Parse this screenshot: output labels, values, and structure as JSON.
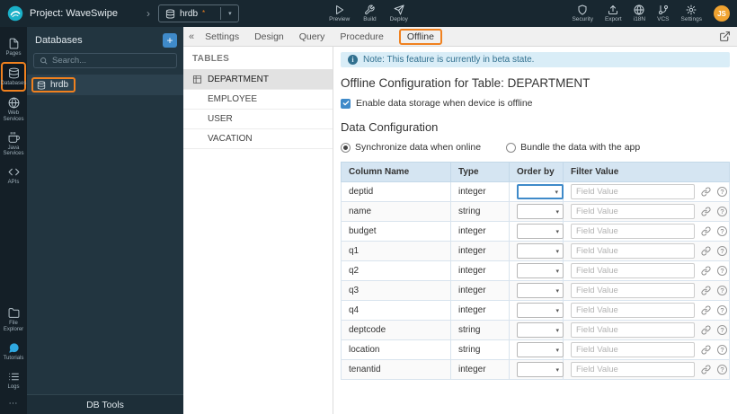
{
  "topbar": {
    "project_label": "Project: WaveSwipe",
    "breadcrumb_chevron": "›",
    "db_selector": {
      "value": "hrdb",
      "modified_marker": "*",
      "caret": "▾"
    },
    "center_actions": [
      {
        "label": "Preview"
      },
      {
        "label": "Build"
      },
      {
        "label": "Deploy"
      }
    ],
    "right_actions": [
      {
        "label": "Security"
      },
      {
        "label": "Export"
      },
      {
        "label": "i18N"
      },
      {
        "label": "VCS"
      },
      {
        "label": "Settings"
      }
    ],
    "avatar_initials": "JS"
  },
  "rail": {
    "items": [
      {
        "label": "Pages"
      },
      {
        "label": "Databases",
        "active": true
      },
      {
        "label": "Web Services"
      },
      {
        "label": "Java Services"
      },
      {
        "label": "APIs"
      },
      {
        "label": "File Explorer"
      },
      {
        "label": "Tutorials"
      },
      {
        "label": "Logs"
      }
    ],
    "overflow": "⋯"
  },
  "db_panel": {
    "title": "Databases",
    "add_button": "+",
    "search_placeholder": "Search...",
    "items": [
      {
        "label": "hrdb",
        "active": true
      }
    ],
    "footer": "DB Tools"
  },
  "tabbar": {
    "collapse_icon": "«",
    "tabs": [
      {
        "label": "Settings"
      },
      {
        "label": "Design"
      },
      {
        "label": "Query"
      },
      {
        "label": "Procedure"
      },
      {
        "label": "Offline",
        "active": true
      }
    ]
  },
  "tables_panel": {
    "title": "TABLES",
    "items": [
      {
        "label": "DEPARTMENT",
        "active": true
      },
      {
        "label": "EMPLOYEE"
      },
      {
        "label": "USER"
      },
      {
        "label": "VACATION"
      }
    ]
  },
  "content": {
    "note": "Note: This feature is currently in beta state.",
    "note_icon": "i",
    "title": "Offline Configuration for Table: DEPARTMENT",
    "enable_checkbox": {
      "label": "Enable data storage when device is offline",
      "checked": true
    },
    "section_title": "Data Configuration",
    "radios": [
      {
        "label": "Synchronize data when online",
        "selected": true
      },
      {
        "label": "Bundle the data with the app",
        "selected": false
      }
    ],
    "table": {
      "headers": [
        "Column Name",
        "Type",
        "Order by",
        "Filter Value"
      ],
      "filter_placeholder": "Field Value",
      "rows": [
        {
          "name": "deptid",
          "type": "integer"
        },
        {
          "name": "name",
          "type": "string"
        },
        {
          "name": "budget",
          "type": "integer"
        },
        {
          "name": "q1",
          "type": "integer"
        },
        {
          "name": "q2",
          "type": "integer"
        },
        {
          "name": "q3",
          "type": "integer"
        },
        {
          "name": "q4",
          "type": "integer"
        },
        {
          "name": "deptcode",
          "type": "string"
        },
        {
          "name": "location",
          "type": "string"
        },
        {
          "name": "tenantid",
          "type": "integer"
        }
      ]
    }
  },
  "colors": {
    "accent_orange": "#f0811f",
    "primary_blue": "#3f8ac9",
    "topbar_bg": "#182730",
    "panel_bg": "#223540",
    "note_bg": "#d9edf7",
    "note_text": "#31708f",
    "table_header_bg": "#d5e5f2",
    "avatar_bg": "#f0a330",
    "tutorials_icon": "#2fa8e0"
  }
}
